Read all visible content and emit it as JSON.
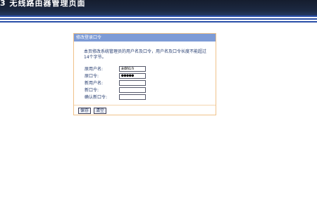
{
  "banner": {
    "title": "3 无线路由器管理页面"
  },
  "panel": {
    "title": "修改登录口令",
    "instructions": "本页修改系统管理员的用户名及口令，用户名及口令长度不能超过14个字节。"
  },
  "form": {
    "fields": [
      {
        "label": "原用户名:",
        "value": "admin"
      },
      {
        "label": "原口令:",
        "value": "●●●●●"
      },
      {
        "label": "新用户名:",
        "value": ""
      },
      {
        "label": "新口令:",
        "value": ""
      },
      {
        "label": "确认新口令:",
        "value": ""
      }
    ]
  },
  "buttons": {
    "save": "保存",
    "clear": "清空"
  },
  "colors": {
    "header_bar": "#151d2e",
    "stripe": "#2a4fa8",
    "panel_header": "#7d9bd6",
    "panel_border": "#f0c28a",
    "text": "#233a6e"
  }
}
